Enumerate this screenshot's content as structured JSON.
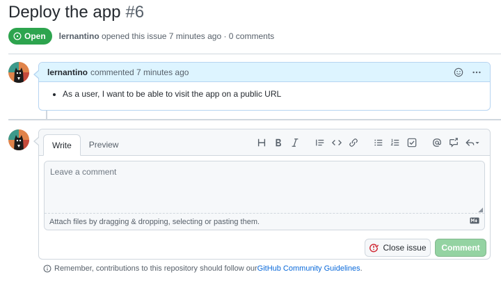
{
  "issue": {
    "title": "Deploy the app",
    "number": "#6",
    "state_label": "Open",
    "state_color": "#2da44e"
  },
  "meta": {
    "author": "lernantino",
    "text": " opened this issue 7 minutes ago · 0 comments"
  },
  "comment": {
    "author": "lernantino",
    "action": "commented 7 minutes ago",
    "body_items": [
      "As a user, I want to be able to visit the app on a public URL"
    ]
  },
  "editor": {
    "tabs": [
      "Write",
      "Preview"
    ],
    "toolbar_icons": [
      "heading-icon",
      "bold-icon",
      "italic-icon",
      "quote-icon",
      "code-icon",
      "link-icon",
      "bulleted-list-icon",
      "numbered-list-icon",
      "task-list-icon",
      "mention-icon",
      "reference-icon",
      "reply-icon"
    ],
    "placeholder": "Leave a comment",
    "attach_hint": "Attach files by dragging & dropping, selecting or pasting them.",
    "close_button": "Close issue",
    "comment_button": "Comment"
  },
  "footer": {
    "text": "Remember, contributions to this repository should follow our ",
    "link": "GitHub Community Guidelines",
    "end": "."
  }
}
